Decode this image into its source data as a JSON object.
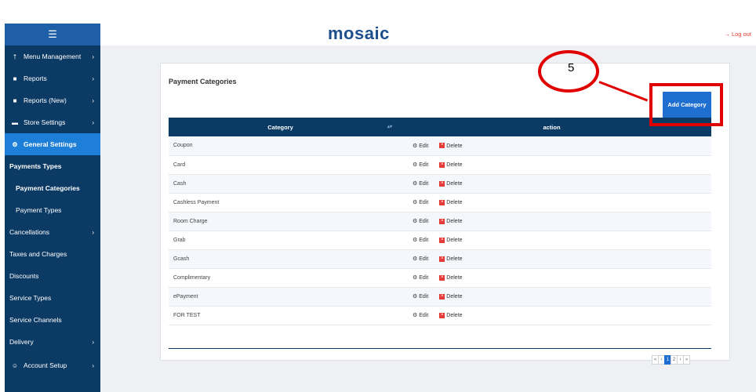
{
  "app": {
    "logo": "mosaic",
    "logout": "Log out"
  },
  "sidebar": {
    "toggle_icon": "☰",
    "items": [
      {
        "label": "Menu Management",
        "icon": "†",
        "chevron": "›"
      },
      {
        "label": "Reports",
        "icon": "■",
        "chevron": "›"
      },
      {
        "label": "Reports (New)",
        "icon": "■",
        "chevron": "›"
      },
      {
        "label": "Store Settings",
        "icon": "▬",
        "chevron": "›"
      },
      {
        "label": "General Settings",
        "icon": "⚙"
      },
      {
        "label": "Payments Types"
      },
      {
        "label": "Payment Categories"
      },
      {
        "label": "Payment Types"
      },
      {
        "label": "Cancellations",
        "chevron": "›"
      },
      {
        "label": "Taxes and Charges"
      },
      {
        "label": "Discounts"
      },
      {
        "label": "Service Types"
      },
      {
        "label": "Service Channels"
      },
      {
        "label": "Delivery",
        "chevron": "›"
      },
      {
        "label": "Account Setup",
        "icon": "☺",
        "chevron": "›"
      }
    ]
  },
  "main": {
    "title": "Payment Categories",
    "add_button": "Add Category",
    "columns": [
      "Category",
      "action"
    ],
    "edit_label": "Edit",
    "delete_label": "Delete",
    "rows": [
      "Coupon",
      "Card",
      "Cash",
      "Cashless Payment",
      "Room Charge",
      "Grab",
      "Gcash",
      "Complimentary",
      "ePayment",
      "FOR TEST"
    ],
    "pagination": [
      "«",
      "‹",
      "1",
      "2",
      "›",
      "»"
    ]
  },
  "annotation": {
    "step_number": "5"
  },
  "colors": {
    "sidebar_bg": "#0b3a64",
    "accent": "#1e6fd0",
    "annotation_red": "#e10000"
  }
}
